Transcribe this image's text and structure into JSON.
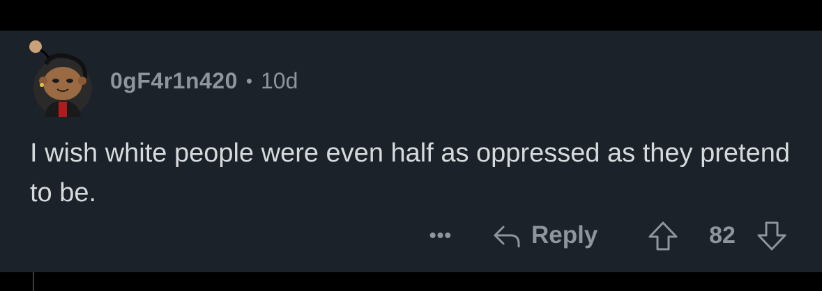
{
  "comment": {
    "username": "0gF4r1n420",
    "separator": "•",
    "age": "10d",
    "body": "I wish white people were even half as oppressed as they pretend to be."
  },
  "actions": {
    "more_label": "•••",
    "reply_label": "Reply",
    "score": "82"
  },
  "icons": {
    "avatar": "avatar-icon",
    "reply": "reply-arrow-icon",
    "upvote": "upvote-arrow-icon",
    "downvote": "downvote-arrow-icon"
  },
  "colors": {
    "background": "#000000",
    "card": "#1b222a",
    "text": "#d7dadc",
    "muted": "#8f959c"
  }
}
